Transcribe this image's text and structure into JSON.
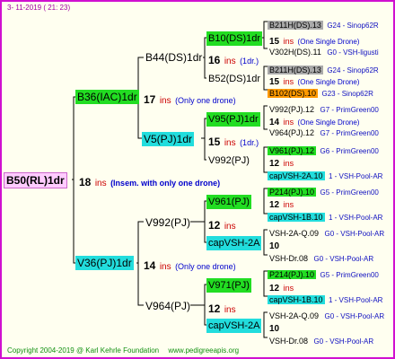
{
  "header": {
    "date": "3- 11-2019 ( 21: 23)"
  },
  "footer": {
    "copyright": "Copyright 2004-2019 @ Karl Kehrle Foundation",
    "site": "www.pedigreeapis.org"
  },
  "root": {
    "name": "B50(RL)1dr",
    "num": "18",
    "ins": "ins",
    "note": "(Insem. with only one drone)"
  },
  "sire": {
    "name": "B36(IAC)1dr",
    "num": "17",
    "ins": "ins",
    "note": "(Only one drone)"
  },
  "dam": {
    "name": "V36(PJ)1dr",
    "num": "14",
    "ins": "ins",
    "note": "(Only one drone)"
  },
  "g3": {
    "b44": {
      "name": "B44(DS)1dr",
      "num": "16",
      "ins": "ins",
      "note": "(1dr.)"
    },
    "v5": {
      "name": "V5(PJ)1dr",
      "num": "15",
      "ins": "ins",
      "note": "(1dr.)"
    },
    "v992": {
      "name": "V992(PJ)",
      "num": "12",
      "ins": "ins"
    },
    "v964": {
      "name": "V964(PJ)",
      "num": "12",
      "ins": "ins"
    }
  },
  "g4": {
    "b10": {
      "name": "B10(DS)1dr",
      "num": "15",
      "ins": "ins",
      "note": "(One Single Drone)"
    },
    "b52": {
      "name": "B52(DS)1dr",
      "num": "15",
      "ins": "ins",
      "note": "(One Single Drone)"
    },
    "v95": {
      "name": "V95(PJ)1dr",
      "num": "14",
      "ins": "ins",
      "note": "(One Single Drone)"
    },
    "v992b": {
      "name": "V992(PJ)",
      "num": "12",
      "ins": "ins"
    },
    "v961": {
      "name": "V961(PJ)",
      "num": "12",
      "ins": "ins"
    },
    "cap1": {
      "name": "capVSH-2A",
      "num": "10"
    },
    "v971": {
      "name": "V971(PJ)",
      "num": "12",
      "ins": "ins"
    },
    "cap2": {
      "name": "capVSH-2A",
      "num": "10"
    }
  },
  "leaves": [
    {
      "name": "B211H(DS).13",
      "grp": "G24 - Sinop62R"
    },
    {
      "name": "V302H(DS).11",
      "grp": "G0 - VSH-ligusti"
    },
    {
      "name": "B211H(DS).13",
      "grp": "G24 - Sinop62R"
    },
    {
      "name": "B102(DS).10",
      "grp": "G23 - Sinop62R"
    },
    {
      "name": "V992(PJ).12",
      "grp": "G7 - PrimGreen00"
    },
    {
      "name": "V964(PJ).12",
      "grp": "G7 - PrimGreen00"
    },
    {
      "name": "V961(PJ).12",
      "grp": "G6 - PrimGreen00"
    },
    {
      "name": "capVSH-2A.10",
      "grp": "1 - VSH-Pool-AR"
    },
    {
      "name": "P214(PJ).10",
      "grp": "G5 - PrimGreen00"
    },
    {
      "name": "capVSH-1B.10",
      "grp": "1 - VSH-Pool-AR"
    },
    {
      "name": "VSH-2A-Q.09",
      "grp": "G0 - VSH-Pool-AR"
    },
    {
      "name": "VSH-Dr.08",
      "grp": "G0 - VSH-Pool-AR"
    },
    {
      "name": "P214(PJ).10",
      "grp": "G5 - PrimGreen00"
    },
    {
      "name": "capVSH-1B.10",
      "grp": "1 - VSH-Pool-AR"
    },
    {
      "name": "VSH-2A-Q.09",
      "grp": "G0 - VSH-Pool-AR"
    },
    {
      "name": "VSH-Dr.08",
      "grp": "G0 - VSH-Pool-AR"
    }
  ]
}
